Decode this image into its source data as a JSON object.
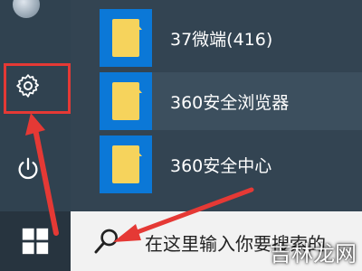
{
  "start_menu": {
    "apps": [
      {
        "label": "37微端(416)",
        "icon": "folder-icon"
      },
      {
        "label": "360安全浏览器",
        "icon": "folder-icon"
      },
      {
        "label": "360安全中心",
        "icon": "folder-icon"
      }
    ],
    "left_rail": {
      "avatar": "user-avatar",
      "settings_icon": "gear-icon",
      "power_icon": "power-icon"
    }
  },
  "taskbar": {
    "start_icon": "windows-logo-icon",
    "search_icon": "search-icon",
    "search_placeholder": "在这里输入你要搜索的"
  },
  "watermark": "吉林龙网",
  "colors": {
    "highlight_red": "#e53935",
    "tile_blue": "#0b78d7",
    "folder_yellow": "#f6d35c"
  }
}
